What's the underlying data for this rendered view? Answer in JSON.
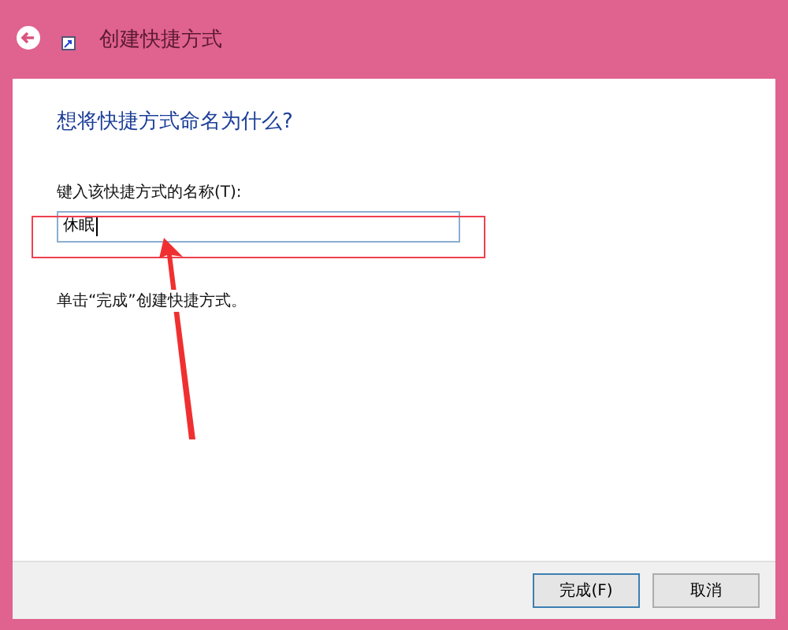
{
  "window": {
    "title": "创建快捷方式"
  },
  "heading": "想将快捷方式命名为什么?",
  "name_field": {
    "label": "键入该快捷方式的名称(T):",
    "value": "休眠"
  },
  "hint": "单击“完成”创建快捷方式。",
  "buttons": [
    {
      "label": "完成(F)",
      "default": true
    },
    {
      "label": "取消",
      "default": false
    }
  ]
}
